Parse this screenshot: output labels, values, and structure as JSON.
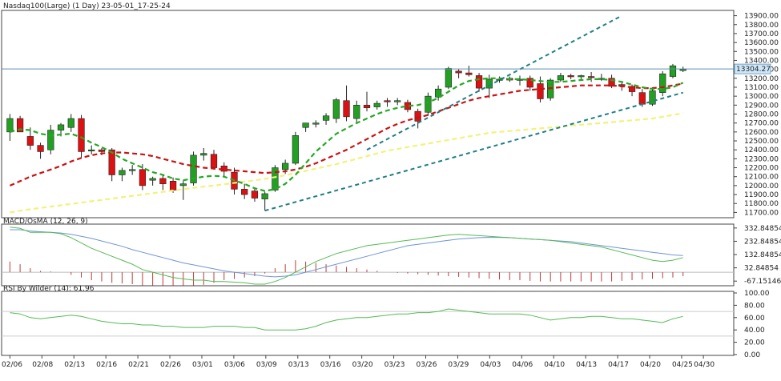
{
  "window": {
    "title": "Nasdaq100(Large) (1 Day) 23-05-01_17-25-24"
  },
  "price_panel": {
    "current_price_label": "13304.27",
    "y_ticks": [
      "13900.00",
      "13800.00",
      "13700.00",
      "13600.00",
      "13500.00",
      "13400.00",
      "13300.00",
      "13200.00",
      "13100.00",
      "13000.00",
      "12900.00",
      "12800.00",
      "12700.00",
      "12600.00",
      "12500.00",
      "12400.00",
      "12300.00",
      "12200.00",
      "12100.00",
      "12000.00",
      "11900.00",
      "11800.00",
      "11700.00"
    ]
  },
  "macd_panel": {
    "title": "MACD/OsMA (12, 26, 9)",
    "y_ticks": [
      "332.84854",
      "232.84854",
      "132.84854",
      "32.84854",
      "-67.15146"
    ]
  },
  "rsi_panel": {
    "title": "RSI By Wilder (14): 61.96",
    "y_ticks": [
      "100.00",
      "80.00",
      "60.00",
      "40.00",
      "20.00",
      "0.00"
    ]
  },
  "x_labels": [
    "02/06",
    "02/08",
    "02/13",
    "02/16",
    "02/21",
    "02/26",
    "03/01",
    "03/06",
    "03/09",
    "03/13",
    "03/16",
    "03/20",
    "03/23",
    "03/26",
    "03/29",
    "04/03",
    "04/06",
    "04/10",
    "04/13",
    "04/17",
    "04/20",
    "04/25",
    "04/30"
  ],
  "colors": {
    "up": "#22a022",
    "down": "#dd1111",
    "ma_fast": "#22aa22",
    "ma_mid": "#cc1111",
    "ma_slow": "#f2f27a",
    "channel": "#1f7f86",
    "macd_signal": "#6f95d6",
    "macd_line": "#55bb55",
    "osma": "#c23a3a",
    "rsi": "#55bb55"
  },
  "chart_data": [
    {
      "type": "candlestick",
      "title": "Nasdaq100(Large) (1 Day) 23-05-01_17-25-24",
      "ylim": [
        11650,
        13950
      ],
      "last": 13304.27,
      "candles": [
        {
          "o": 12600,
          "h": 12800,
          "l": 12500,
          "c": 12750
        },
        {
          "o": 12750,
          "h": 12780,
          "l": 12600,
          "c": 12600
        },
        {
          "o": 12550,
          "h": 12650,
          "l": 12400,
          "c": 12450
        },
        {
          "o": 12450,
          "h": 12480,
          "l": 12300,
          "c": 12380
        },
        {
          "o": 12400,
          "h": 12680,
          "l": 12350,
          "c": 12620
        },
        {
          "o": 12620,
          "h": 12700,
          "l": 12550,
          "c": 12680
        },
        {
          "o": 12650,
          "h": 12800,
          "l": 12600,
          "c": 12750
        },
        {
          "o": 12750,
          "h": 12790,
          "l": 12300,
          "c": 12380
        },
        {
          "o": 12400,
          "h": 12450,
          "l": 12350,
          "c": 12400
        },
        {
          "o": 12400,
          "h": 12420,
          "l": 12340,
          "c": 12380
        },
        {
          "o": 12400,
          "h": 12420,
          "l": 12050,
          "c": 12120
        },
        {
          "o": 12120,
          "h": 12200,
          "l": 12050,
          "c": 12170
        },
        {
          "o": 12180,
          "h": 12230,
          "l": 12120,
          "c": 12180
        },
        {
          "o": 12180,
          "h": 12240,
          "l": 11950,
          "c": 12000
        },
        {
          "o": 12060,
          "h": 12100,
          "l": 12000,
          "c": 12080
        },
        {
          "o": 12080,
          "h": 12120,
          "l": 11950,
          "c": 12020
        },
        {
          "o": 12050,
          "h": 12090,
          "l": 11920,
          "c": 11950
        },
        {
          "o": 12000,
          "h": 12060,
          "l": 11840,
          "c": 12020
        },
        {
          "o": 12030,
          "h": 12380,
          "l": 12000,
          "c": 12340
        },
        {
          "o": 12340,
          "h": 12420,
          "l": 12280,
          "c": 12360
        },
        {
          "o": 12350,
          "h": 12400,
          "l": 12180,
          "c": 12200
        },
        {
          "o": 12220,
          "h": 12260,
          "l": 12100,
          "c": 12160
        },
        {
          "o": 12150,
          "h": 12200,
          "l": 11900,
          "c": 11960
        },
        {
          "o": 11960,
          "h": 12020,
          "l": 11850,
          "c": 11900
        },
        {
          "o": 11940,
          "h": 11980,
          "l": 11820,
          "c": 11860
        },
        {
          "o": 11850,
          "h": 11930,
          "l": 11720,
          "c": 11910
        },
        {
          "o": 11950,
          "h": 12230,
          "l": 11930,
          "c": 12200
        },
        {
          "o": 12180,
          "h": 12290,
          "l": 12130,
          "c": 12250
        },
        {
          "o": 12250,
          "h": 12600,
          "l": 12230,
          "c": 12560
        },
        {
          "o": 12650,
          "h": 12700,
          "l": 12600,
          "c": 12700
        },
        {
          "o": 12700,
          "h": 12730,
          "l": 12650,
          "c": 12700
        },
        {
          "o": 12730,
          "h": 12810,
          "l": 12680,
          "c": 12780
        },
        {
          "o": 12750,
          "h": 12980,
          "l": 12700,
          "c": 12960
        },
        {
          "o": 12950,
          "h": 13120,
          "l": 12720,
          "c": 12770
        },
        {
          "o": 12750,
          "h": 12950,
          "l": 12700,
          "c": 12900
        },
        {
          "o": 12900,
          "h": 13050,
          "l": 12830,
          "c": 12870
        },
        {
          "o": 12880,
          "h": 12950,
          "l": 12850,
          "c": 12920
        },
        {
          "o": 12950,
          "h": 12980,
          "l": 12880,
          "c": 12940
        },
        {
          "o": 12940,
          "h": 12980,
          "l": 12900,
          "c": 12950
        },
        {
          "o": 12930,
          "h": 12960,
          "l": 12820,
          "c": 12850
        },
        {
          "o": 12830,
          "h": 12860,
          "l": 12640,
          "c": 12720
        },
        {
          "o": 12820,
          "h": 13040,
          "l": 12780,
          "c": 13000
        },
        {
          "o": 12990,
          "h": 13120,
          "l": 12950,
          "c": 13080
        },
        {
          "o": 13100,
          "h": 13330,
          "l": 13080,
          "c": 13310
        },
        {
          "o": 13280,
          "h": 13300,
          "l": 13200,
          "c": 13260
        },
        {
          "o": 13260,
          "h": 13340,
          "l": 13220,
          "c": 13240
        },
        {
          "o": 13230,
          "h": 13260,
          "l": 13050,
          "c": 13090
        },
        {
          "o": 13090,
          "h": 13240,
          "l": 12980,
          "c": 13190
        },
        {
          "o": 13190,
          "h": 13220,
          "l": 13150,
          "c": 13190
        },
        {
          "o": 13200,
          "h": 13220,
          "l": 13160,
          "c": 13180
        },
        {
          "o": 13180,
          "h": 13230,
          "l": 13120,
          "c": 13190
        },
        {
          "o": 13200,
          "h": 13230,
          "l": 13060,
          "c": 13100
        },
        {
          "o": 13140,
          "h": 13220,
          "l": 12930,
          "c": 12970
        },
        {
          "o": 12980,
          "h": 13200,
          "l": 12950,
          "c": 13180
        },
        {
          "o": 13180,
          "h": 13260,
          "l": 13160,
          "c": 13230
        },
        {
          "o": 13230,
          "h": 13250,
          "l": 13190,
          "c": 13220
        },
        {
          "o": 13220,
          "h": 13240,
          "l": 13180,
          "c": 13230
        },
        {
          "o": 13220,
          "h": 13270,
          "l": 13160,
          "c": 13210
        },
        {
          "o": 13200,
          "h": 13250,
          "l": 13170,
          "c": 13200
        },
        {
          "o": 13200,
          "h": 13240,
          "l": 13090,
          "c": 13110
        },
        {
          "o": 13130,
          "h": 13150,
          "l": 13060,
          "c": 13110
        },
        {
          "o": 13110,
          "h": 13130,
          "l": 13000,
          "c": 13050
        },
        {
          "o": 13040,
          "h": 13080,
          "l": 12880,
          "c": 12910
        },
        {
          "o": 12910,
          "h": 13080,
          "l": 12890,
          "c": 13060
        },
        {
          "o": 13040,
          "h": 13280,
          "l": 13000,
          "c": 13250
        },
        {
          "o": 13220,
          "h": 13360,
          "l": 13200,
          "c": 13340
        },
        {
          "o": 13290,
          "h": 13330,
          "l": 13270,
          "c": 13300
        }
      ],
      "ma_fast": [
        12600,
        12630,
        12620,
        12580,
        12560,
        12570,
        12580,
        12540,
        12480,
        12430,
        12370,
        12300,
        12250,
        12200,
        12150,
        12120,
        12080,
        12060,
        12080,
        12100,
        12110,
        12100,
        12060,
        12020,
        11970,
        11940,
        11960,
        12020,
        12120,
        12250,
        12380,
        12480,
        12580,
        12640,
        12700,
        12750,
        12800,
        12840,
        12870,
        12890,
        12900,
        12930,
        12980,
        13050,
        13120,
        13170,
        13190,
        13200,
        13200,
        13190,
        13190,
        13180,
        13170,
        13160,
        13160,
        13170,
        13180,
        13190,
        13190,
        13180,
        13160,
        13130,
        13100,
        13080,
        13080,
        13100,
        13150
      ],
      "ma_mid": [
        12000,
        12050,
        12100,
        12140,
        12180,
        12220,
        12270,
        12310,
        12340,
        12360,
        12370,
        12370,
        12360,
        12350,
        12330,
        12300,
        12270,
        12240,
        12220,
        12200,
        12190,
        12180,
        12170,
        12160,
        12150,
        12140,
        12150,
        12160,
        12180,
        12210,
        12250,
        12300,
        12350,
        12400,
        12460,
        12520,
        12580,
        12640,
        12690,
        12730,
        12760,
        12790,
        12830,
        12870,
        12910,
        12950,
        12980,
        13000,
        13020,
        13040,
        13060,
        13070,
        13080,
        13090,
        13100,
        13110,
        13120,
        13120,
        13120,
        13120,
        13110,
        13100,
        13090,
        13090,
        13100,
        13120,
        13140
      ],
      "ma_slow": [
        11700,
        11720,
        11735,
        11750,
        11765,
        11780,
        11795,
        11810,
        11825,
        11840,
        11855,
        11870,
        11885,
        11900,
        11915,
        11930,
        11945,
        11960,
        11975,
        11990,
        12000,
        12015,
        12030,
        12045,
        12060,
        12075,
        12095,
        12115,
        12140,
        12165,
        12190,
        12215,
        12240,
        12270,
        12300,
        12330,
        12360,
        12390,
        12410,
        12430,
        12450,
        12470,
        12490,
        12510,
        12530,
        12550,
        12570,
        12590,
        12600,
        12610,
        12620,
        12630,
        12640,
        12650,
        12660,
        12670,
        12680,
        12690,
        12700,
        12710,
        12720,
        12730,
        12740,
        12750,
        12770,
        12790,
        12810
      ],
      "channel_upper": {
        "from": [
          35,
          12400
        ],
        "to": [
          60,
          13900
        ]
      },
      "channel_lower": {
        "from": [
          25,
          11720
        ],
        "to": [
          66,
          13040
        ]
      }
    },
    {
      "type": "line",
      "title": "MACD/OsMA (12, 26, 9)",
      "ylim": [
        -90,
        350
      ],
      "macd": [
        340,
        330,
        300,
        300,
        300,
        290,
        260,
        220,
        180,
        150,
        120,
        90,
        60,
        20,
        0,
        -20,
        -40,
        -50,
        -60,
        -60,
        -70,
        -70,
        -75,
        -80,
        -90,
        -90,
        -70,
        -40,
        0,
        40,
        80,
        110,
        140,
        160,
        180,
        200,
        210,
        220,
        230,
        240,
        250,
        260,
        270,
        280,
        285,
        280,
        275,
        270,
        265,
        260,
        255,
        250,
        245,
        240,
        230,
        220,
        210,
        200,
        190,
        170,
        150,
        130,
        110,
        90,
        80,
        90,
        110
      ],
      "signal": [
        320,
        320,
        310,
        305,
        300,
        295,
        285,
        270,
        255,
        235,
        215,
        195,
        170,
        150,
        130,
        110,
        90,
        70,
        55,
        40,
        25,
        10,
        0,
        -10,
        -20,
        -30,
        -35,
        -30,
        -20,
        0,
        20,
        40,
        60,
        80,
        100,
        120,
        140,
        160,
        180,
        200,
        210,
        220,
        230,
        240,
        250,
        255,
        260,
        262,
        262,
        260,
        255,
        250,
        245,
        240,
        235,
        230,
        220,
        210,
        200,
        190,
        180,
        170,
        160,
        150,
        140,
        130,
        125
      ],
      "osma": [
        80,
        60,
        30,
        10,
        5,
        0,
        -20,
        -40,
        -60,
        -70,
        -80,
        -85,
        -90,
        -100,
        -100,
        -100,
        -100,
        -100,
        -100,
        -95,
        -80,
        -60,
        -50,
        -40,
        -30,
        -10,
        30,
        60,
        90,
        80,
        70,
        60,
        50,
        40,
        30,
        20,
        10,
        0,
        -5,
        -10,
        -15,
        -20,
        -25,
        -30,
        -35,
        -40,
        -45,
        -50,
        -55,
        -60,
        -60,
        -65,
        -70,
        -70,
        -70,
        -70,
        -70,
        -70,
        -70,
        -70,
        -65,
        -60,
        -55,
        -50,
        -45,
        -40,
        -30
      ]
    },
    {
      "type": "line",
      "title": "RSI By Wilder (14): 61.96",
      "ylim": [
        0,
        100
      ],
      "rsi": [
        68,
        66,
        60,
        58,
        60,
        62,
        64,
        62,
        58,
        54,
        52,
        50,
        50,
        48,
        48,
        46,
        46,
        44,
        44,
        44,
        46,
        46,
        46,
        44,
        44,
        40,
        40,
        40,
        40,
        42,
        46,
        52,
        56,
        58,
        60,
        60,
        62,
        64,
        66,
        66,
        68,
        68,
        70,
        74,
        72,
        70,
        68,
        66,
        66,
        66,
        66,
        64,
        60,
        56,
        58,
        60,
        60,
        62,
        62,
        60,
        58,
        58,
        56,
        54,
        52,
        58,
        62
      ]
    }
  ]
}
